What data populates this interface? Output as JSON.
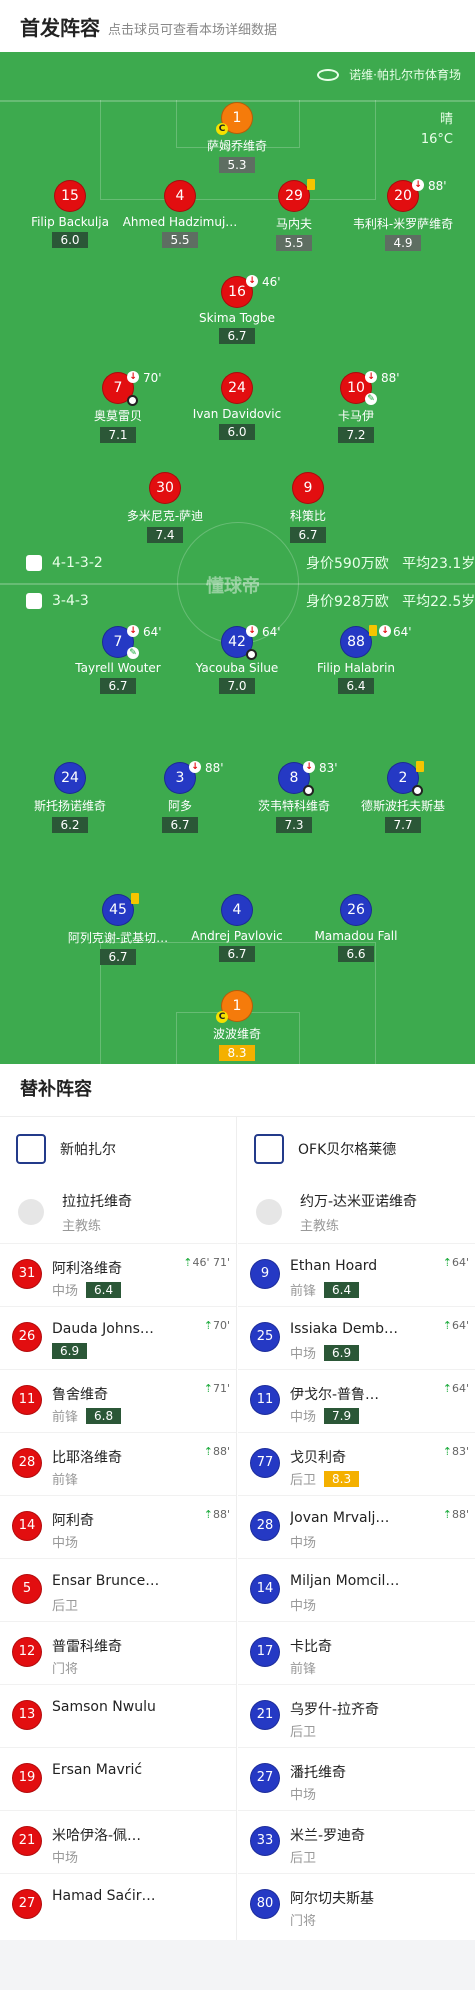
{
  "header": {
    "title": "首发阵容",
    "subtitle": "点击球员可查看本场详细数据"
  },
  "match": {
    "venue": "诺维·帕扎尔市体育场",
    "weather": "晴",
    "temperature": "16°C",
    "watermark": "懂球帝"
  },
  "home": {
    "formation": "4-1-3-2",
    "value": "身价590万欧",
    "age": "平均23.1岁",
    "players": [
      {
        "num": "1",
        "name": "萨姆乔维奇",
        "rating": "5.3",
        "color": "orange"
      },
      {
        "num": "15",
        "name": "Filip Backulja",
        "rating": "6.0",
        "color": "red"
      },
      {
        "num": "4",
        "name": "Ahmed Hadzimuj…",
        "rating": "5.5",
        "color": "red"
      },
      {
        "num": "29",
        "name": "马内夫",
        "rating": "5.5",
        "color": "red"
      },
      {
        "num": "20",
        "name": "韦利科-米罗萨维奇",
        "rating": "4.9",
        "color": "red",
        "event": "88'"
      },
      {
        "num": "16",
        "name": "Skima Togbe",
        "rating": "6.7",
        "color": "red",
        "event": "46'"
      },
      {
        "num": "7",
        "name": "奥莫雷贝",
        "rating": "7.1",
        "color": "red",
        "event": "70'"
      },
      {
        "num": "24",
        "name": "Ivan Davidovic",
        "rating": "6.0",
        "color": "red"
      },
      {
        "num": "10",
        "name": "卡马伊",
        "rating": "7.2",
        "color": "red",
        "event": "88'"
      },
      {
        "num": "30",
        "name": "多米尼克-萨迪",
        "rating": "7.4",
        "color": "red"
      },
      {
        "num": "9",
        "name": "科策比",
        "rating": "6.7",
        "color": "red"
      }
    ]
  },
  "away": {
    "formation": "3-4-3",
    "value": "身价928万欧",
    "age": "平均22.5岁",
    "players": [
      {
        "num": "7",
        "name": "Tayrell Wouter",
        "rating": "6.7",
        "color": "blue",
        "event": "64'"
      },
      {
        "num": "42",
        "name": "Yacouba Silue",
        "rating": "7.0",
        "color": "blue",
        "event": "64'"
      },
      {
        "num": "88",
        "name": "Filip Halabrin",
        "rating": "6.4",
        "color": "blue",
        "event": "64'"
      },
      {
        "num": "24",
        "name": "斯托扬诺维奇",
        "rating": "6.2",
        "color": "blue"
      },
      {
        "num": "3",
        "name": "阿多",
        "rating": "6.7",
        "color": "blue",
        "event": "88'"
      },
      {
        "num": "8",
        "name": "茨韦特科维奇",
        "rating": "7.3",
        "color": "blue",
        "event": "83'"
      },
      {
        "num": "2",
        "name": "德斯波托夫斯基",
        "rating": "7.7",
        "color": "blue"
      },
      {
        "num": "45",
        "name": "阿列克谢-武基切…",
        "rating": "6.7",
        "color": "blue"
      },
      {
        "num": "4",
        "name": "Andrej Pavlovic",
        "rating": "6.7",
        "color": "blue"
      },
      {
        "num": "26",
        "name": "Mamadou Fall",
        "rating": "6.6",
        "color": "blue"
      },
      {
        "num": "1",
        "name": "波波维奇",
        "rating": "8.3",
        "color": "orange"
      }
    ]
  },
  "substitutes": {
    "title": "替补阵容",
    "home": {
      "team": "新帕扎尔",
      "coach": {
        "name": "拉拉托维奇",
        "role": "主教练"
      },
      "list": [
        {
          "num": "31",
          "name": "阿利洛维奇",
          "pos": "中场",
          "rating": "6.4",
          "events": "46' 71'"
        },
        {
          "num": "26",
          "name": "Dauda Johns…",
          "pos": "",
          "rating": "6.9",
          "events": "70'"
        },
        {
          "num": "11",
          "name": "鲁舍维奇",
          "pos": "前锋",
          "rating": "6.8",
          "events": "71'"
        },
        {
          "num": "28",
          "name": "比耶洛维奇",
          "pos": "前锋",
          "rating": "",
          "events": "88'"
        },
        {
          "num": "14",
          "name": "阿利奇",
          "pos": "中场",
          "rating": "",
          "events": "88'"
        },
        {
          "num": "5",
          "name": "Ensar Brunce…",
          "pos": "后卫",
          "rating": "",
          "events": ""
        },
        {
          "num": "12",
          "name": "普雷科维奇",
          "pos": "门将",
          "rating": "",
          "events": ""
        },
        {
          "num": "13",
          "name": "Samson Nwulu",
          "pos": "",
          "rating": "",
          "events": ""
        },
        {
          "num": "19",
          "name": "Ersan Mavrić",
          "pos": "",
          "rating": "",
          "events": ""
        },
        {
          "num": "21",
          "name": "米哈伊洛-佩…",
          "pos": "中场",
          "rating": "",
          "events": ""
        },
        {
          "num": "27",
          "name": "Hamad Saćir…",
          "pos": "",
          "rating": "",
          "events": ""
        }
      ]
    },
    "away": {
      "team": "OFK贝尔格莱德",
      "coach": {
        "name": "约万-达米亚诺维奇",
        "role": "主教练"
      },
      "list": [
        {
          "num": "9",
          "name": "Ethan Hoard",
          "pos": "前锋",
          "rating": "6.4",
          "events": "64'"
        },
        {
          "num": "25",
          "name": "Issiaka Demb…",
          "pos": "中场",
          "rating": "6.9",
          "events": "64'"
        },
        {
          "num": "11",
          "name": "伊戈尔-普鲁…",
          "pos": "中场",
          "rating": "7.9",
          "events": "64'"
        },
        {
          "num": "77",
          "name": "戈贝利奇",
          "pos": "后卫",
          "rating": "8.3",
          "events": "83'"
        },
        {
          "num": "28",
          "name": "Jovan Mrvalj…",
          "pos": "中场",
          "rating": "",
          "events": "88'"
        },
        {
          "num": "14",
          "name": "Miljan Momcil…",
          "pos": "中场",
          "rating": "",
          "events": ""
        },
        {
          "num": "17",
          "name": "卡比奇",
          "pos": "前锋",
          "rating": "",
          "events": ""
        },
        {
          "num": "21",
          "name": "乌罗什-拉齐奇",
          "pos": "后卫",
          "rating": "",
          "events": ""
        },
        {
          "num": "27",
          "name": "潘托维奇",
          "pos": "中场",
          "rating": "",
          "events": ""
        },
        {
          "num": "33",
          "name": "米兰-罗迪奇",
          "pos": "后卫",
          "rating": "",
          "events": ""
        },
        {
          "num": "80",
          "name": "阿尔切夫斯基",
          "pos": "门将",
          "rating": "",
          "events": ""
        }
      ]
    }
  }
}
